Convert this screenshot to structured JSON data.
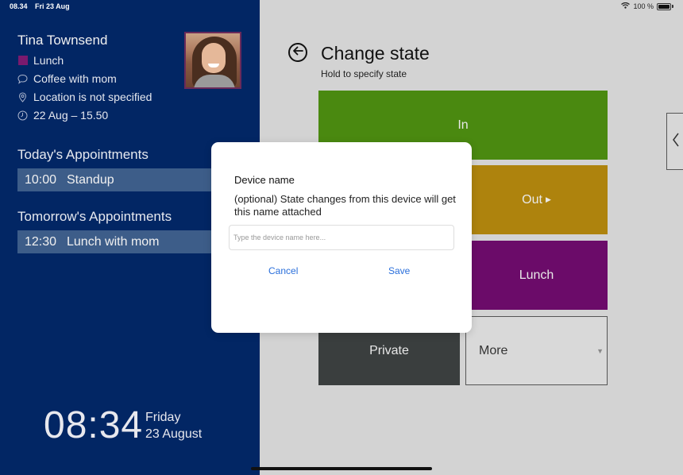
{
  "status_bar": {
    "time": "08.34",
    "date": "Fri 23 Aug",
    "battery": "100 %"
  },
  "profile": {
    "name": "Tina Townsend",
    "state": "Lunch",
    "state_color": "#7a1a6e",
    "comment": "Coffee with mom",
    "location": "Location is not specified",
    "until": "22 Aug – 15.50"
  },
  "appointments": {
    "today_title": "Today's Appointments",
    "today": [
      {
        "time": "10:00",
        "title": "Standup"
      }
    ],
    "tomorrow_title": "Tomorrow's Appointments",
    "tomorrow": [
      {
        "time": "12:30",
        "title": "Lunch with mom"
      }
    ]
  },
  "clock": {
    "time": "08:34",
    "day": "Friday",
    "date": "23 August"
  },
  "change_state": {
    "title": "Change state",
    "subtitle": "Hold to specify state",
    "tiles": {
      "in": "In",
      "out": "Out",
      "lunch": "Lunch",
      "private": "Private",
      "more": "More"
    },
    "colors": {
      "in": "#4a8910",
      "out": "#ae830d",
      "lunch": "#6b0b69",
      "private": "#3a3e3e"
    }
  },
  "dialog": {
    "title": "Device name",
    "description": "(optional) State changes from this device will get this name attached",
    "input_placeholder": "Type the device name here...",
    "input_value": "",
    "cancel_label": "Cancel",
    "save_label": "Save"
  }
}
